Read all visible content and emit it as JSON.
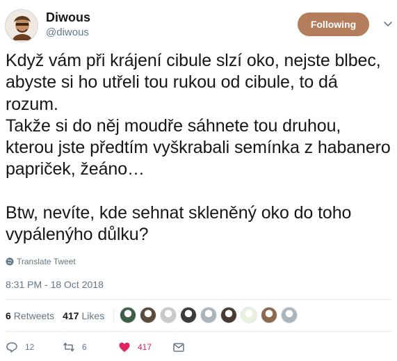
{
  "user": {
    "name": "Diwous",
    "handle": "@diwous"
  },
  "follow_button": {
    "label": "Following",
    "color": "#b47e5d"
  },
  "tweet": {
    "text": "Když vám při krájení cibule slzí oko, nejste blbec, abyste si ho utřeli tou rukou od cibule, to dá rozum.\nTakže si do něj moudře sáhnete tou druhou, kterou jste předtím vyškrabali semínka z habanero papriček, žeáno…\n\nBtw, nevíte, kde sehnat skleněný oko do toho vypálenýho důlku?",
    "translate_label": "Translate Tweet",
    "timestamp": "8:31 PM - 18 Oct 2018"
  },
  "stats": {
    "retweets_count": "6",
    "retweets_label": "Retweets",
    "likes_count": "417",
    "likes_label": "Likes"
  },
  "likers": [
    {
      "color": "#3f5e4a"
    },
    {
      "color": "#5a4b3c"
    },
    {
      "color": "#c9c9c9"
    },
    {
      "color": "#3b3b3b"
    },
    {
      "color": "#a9b4bd"
    },
    {
      "color": "#4b3a33"
    },
    {
      "color": "#e8f2dc"
    },
    {
      "color": "#8c6a4f"
    },
    {
      "color": "#a9b4bd"
    }
  ],
  "actions": {
    "reply_count": "12",
    "retweet_count": "6",
    "like_count": "417",
    "like_color": "#e0245e"
  },
  "icons": [
    "chevron-down-icon",
    "globe-icon",
    "reply-icon",
    "retweet-icon",
    "heart-icon",
    "message-icon"
  ]
}
